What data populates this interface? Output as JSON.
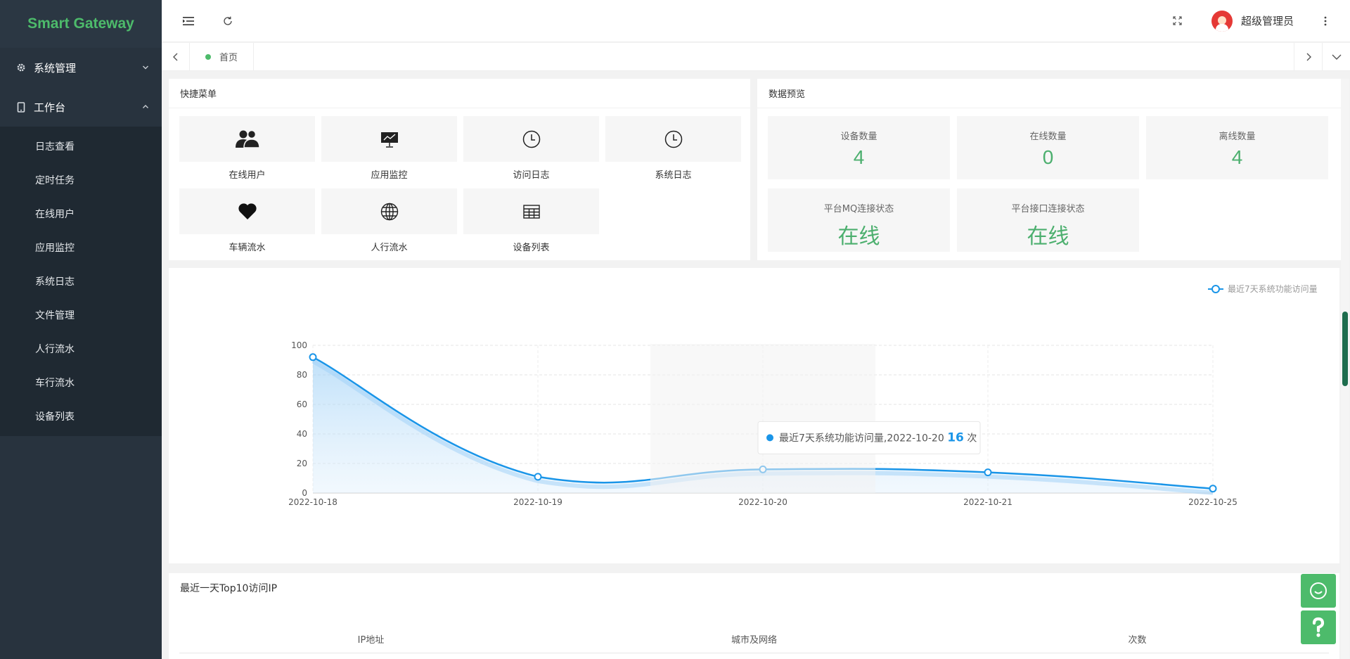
{
  "app": {
    "title": "Smart Gateway"
  },
  "sidebar": {
    "groups": [
      {
        "label": "系统管理",
        "icon": "gear-icon",
        "expanded": false
      },
      {
        "label": "工作台",
        "icon": "tablet-icon",
        "expanded": true
      }
    ],
    "items": [
      {
        "label": "日志查看"
      },
      {
        "label": "定时任务"
      },
      {
        "label": "在线用户"
      },
      {
        "label": "应用监控"
      },
      {
        "label": "系统日志"
      },
      {
        "label": "文件管理"
      },
      {
        "label": "人行流水"
      },
      {
        "label": "车行流水"
      },
      {
        "label": "设备列表"
      }
    ]
  },
  "header": {
    "username": "超级管理员"
  },
  "tabs": [
    {
      "label": "首页",
      "active": true
    }
  ],
  "quick_menu": {
    "title": "快捷菜单",
    "items": [
      {
        "label": "在线用户",
        "icon": "users-icon"
      },
      {
        "label": "应用监控",
        "icon": "presentation-icon"
      },
      {
        "label": "访问日志",
        "icon": "clock-icon"
      },
      {
        "label": "系统日志",
        "icon": "clock-icon"
      },
      {
        "label": "车辆流水",
        "icon": "heart-icon"
      },
      {
        "label": "人行流水",
        "icon": "globe-icon"
      },
      {
        "label": "设备列表",
        "icon": "table-icon"
      }
    ]
  },
  "data_preview": {
    "title": "数据预览",
    "stats": [
      {
        "label": "设备数量",
        "value": "4"
      },
      {
        "label": "在线数量",
        "value": "0"
      },
      {
        "label": "离线数量",
        "value": "4"
      },
      {
        "label": "平台MQ连接状态",
        "value": "在线"
      },
      {
        "label": "平台接口连接状态",
        "value": "在线"
      }
    ]
  },
  "chart_data": {
    "type": "area",
    "legend": "最近7天系统功能访问量",
    "legend_position": "top-right",
    "x": [
      "2022-10-18",
      "2022-10-19",
      "2022-10-20",
      "2022-10-21",
      "2022-10-25"
    ],
    "series": [
      {
        "name": "最近7天系统功能访问量",
        "values": [
          92,
          11,
          16,
          14,
          3
        ]
      }
    ],
    "ylim": [
      0,
      100
    ],
    "yticks": [
      "0",
      "20",
      "40",
      "60",
      "80",
      "100"
    ],
    "grid": true,
    "color": "#1a95e8",
    "tooltip": {
      "series": "最近7天系统功能访问量",
      "date": "2022-10-20",
      "value": "16",
      "unit": "次"
    }
  },
  "ip_table": {
    "title": "最近一天Top10访问IP",
    "columns": [
      "IP地址",
      "城市及网络",
      "次数"
    ]
  },
  "colors": {
    "accent": "#4dbb6b",
    "sidebar": "#28333e",
    "chart": "#1a95e8"
  }
}
